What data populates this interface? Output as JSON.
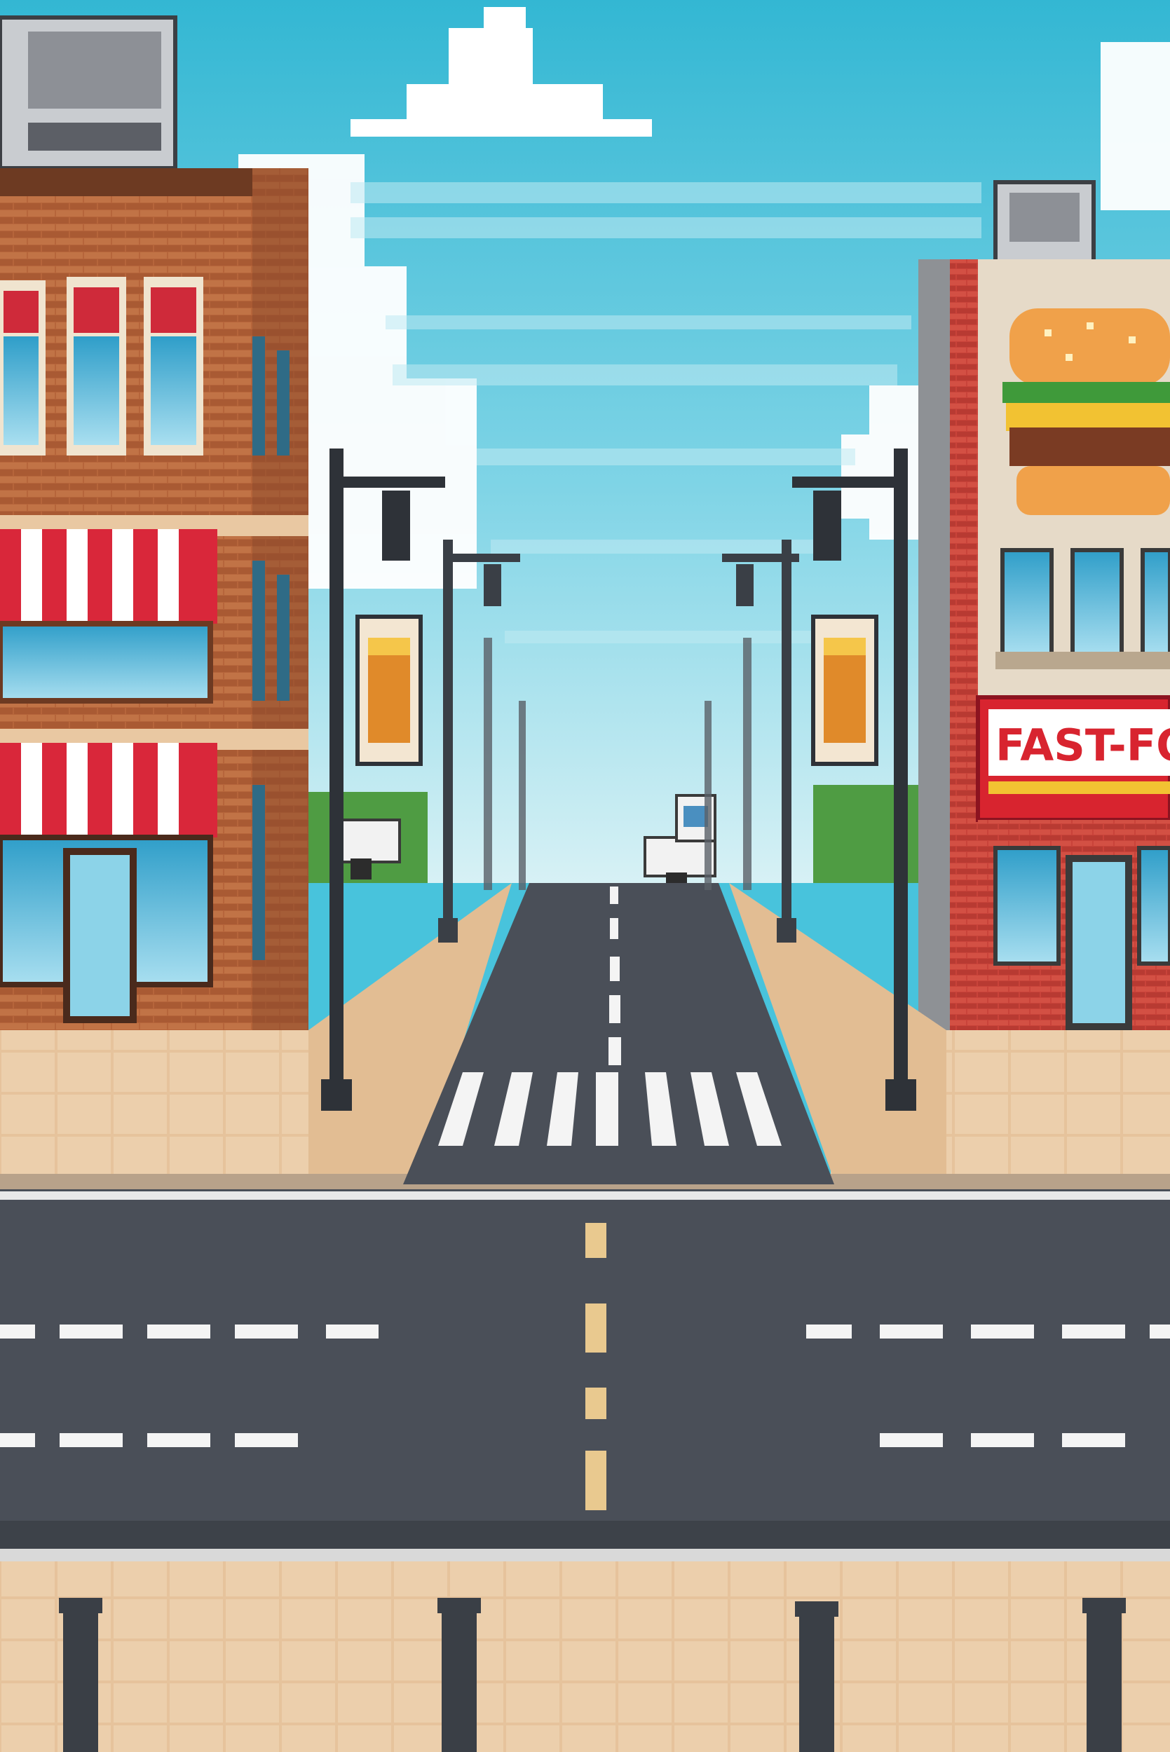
{
  "scene": {
    "description_type": "pixel-art street intersection",
    "right_building": {
      "sign_text": "FAST-FOA",
      "logo_icon": "hamburger-icon"
    },
    "left_building": {
      "awning_colors": [
        "#d9273a",
        "#ffffff"
      ]
    },
    "hanging_signs_icon": "fries-box-icon",
    "vehicles": [
      "pickup-truck",
      "white-car"
    ]
  },
  "colors": {
    "sky_top": "#3bbcd6",
    "sky_bottom": "#c4ecf3",
    "brick": "#b8663a",
    "asphalt": "#4a4f58",
    "sidewalk": "#e8c9a1",
    "sign_red": "#d8242f",
    "sign_yellow": "#f2c232",
    "lane_white": "#f4f4f4",
    "lane_yellow": "#e9c98f"
  }
}
